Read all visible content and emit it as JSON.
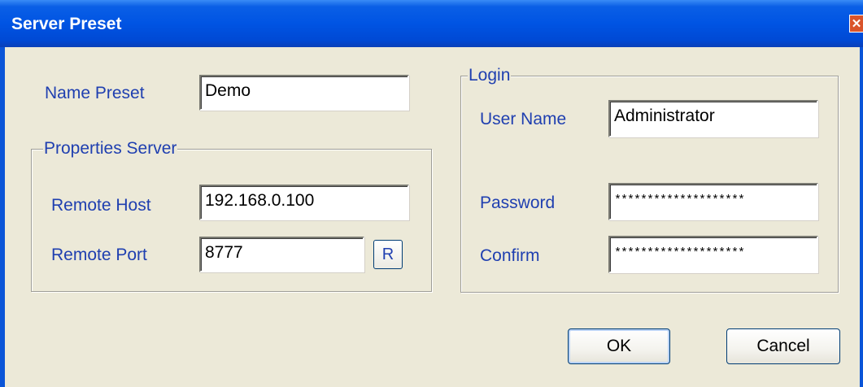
{
  "window": {
    "title": "Server Preset",
    "close_glyph": "✕"
  },
  "preset": {
    "name_label": "Name Preset",
    "name_value": "Demo"
  },
  "server": {
    "group_label": "Properties Server",
    "host_label": "Remote Host",
    "host_value": "192.168.0.100",
    "port_label": "Remote Port",
    "port_value": "8777",
    "reset_button": "R"
  },
  "login": {
    "group_label": "Login",
    "user_label": "User Name",
    "user_value": "Administrator",
    "password_label": "Password",
    "password_value": "********************",
    "confirm_label": "Confirm",
    "confirm_value": "********************"
  },
  "buttons": {
    "ok": "OK",
    "cancel": "Cancel"
  },
  "colors": {
    "titlebar": "#0054e3",
    "label_text": "#1f3fb0",
    "dialog_bg": "#ece9d8"
  }
}
